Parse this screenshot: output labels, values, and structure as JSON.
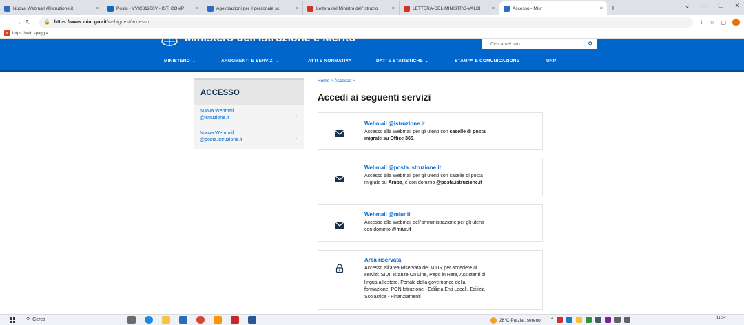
{
  "browser": {
    "tabs": [
      {
        "title": "Nuova Webmail @istruzione.it",
        "color": "#2b6cc4"
      },
      {
        "title": "Posta - VVIC81200V - IST. COMP",
        "color": "#0f6cbd"
      },
      {
        "title": "Agevolazioni per il personale sc",
        "color": "#2b6cc4"
      },
      {
        "title": "Lettera del Ministro dell'Istruzio",
        "color": "#d93025"
      },
      {
        "title": "LETTERA-DEL-MINISTRO-VALDI",
        "color": "#d93025"
      },
      {
        "title": "Accesso - Miur",
        "color": "#2b6cc4",
        "active": true
      }
    ],
    "url_host": "https://www.miur.gov.it",
    "url_path": "/web/guest/accesso",
    "bookmark": "https://web.spaggia..."
  },
  "site": {
    "title": "Ministero dell'Istruzione e Merito",
    "search_placeholder": "Cerca nel sito",
    "nav": [
      {
        "label": "MINISTERO",
        "caret": true
      },
      {
        "label": "ARGOMENTI E SERVIZI",
        "caret": true
      },
      {
        "label": "ATTI E NORMATIVA",
        "caret": false
      },
      {
        "label": "DATI E STATISTICHE",
        "caret": true
      },
      {
        "label": "STAMPA E COMUNICAZIONE",
        "caret": false
      },
      {
        "label": "URP",
        "caret": false
      }
    ]
  },
  "sidebar": {
    "heading": "ACCESSO",
    "items": [
      {
        "line1": "Nuova Webmail",
        "line2": "@istruzione.it"
      },
      {
        "line1": "Nuova Webmail",
        "line2": "@posta.istruzione.it"
      }
    ]
  },
  "main": {
    "breadcrumb": "Home > Accesso >",
    "title": "Accedi ai seguenti servizi",
    "cards": [
      {
        "icon": "mail-icon",
        "title": "Webmail @istruzione.it",
        "desc_lines": [
          [
            {
              "t": "Accesso alla Webmail per gli utenti con "
            },
            {
              "t": "caselle di posta",
              "b": true
            }
          ],
          [
            {
              "t": "migrate su Office 365",
              "b": true
            },
            {
              "t": "."
            }
          ]
        ]
      },
      {
        "icon": "mail-icon",
        "title": "Webmail @posta.istruzione.it",
        "desc_lines": [
          [
            {
              "t": "Accesso alla Webmail per gli utenti con caselle di posta"
            }
          ],
          [
            {
              "t": "migrate su "
            },
            {
              "t": "Aruba",
              "b": true
            },
            {
              "t": ", e con dominio "
            },
            {
              "t": "@posta.istruzione.it",
              "b": true
            }
          ]
        ]
      },
      {
        "icon": "mail-icon",
        "title": "Webmail @miur.it",
        "desc_lines": [
          [
            {
              "t": "Accesso alla Webmail dell'amministrazione per gli utenti"
            }
          ],
          [
            {
              "t": "con dominio "
            },
            {
              "t": "@miur.it",
              "b": true
            }
          ]
        ]
      },
      {
        "icon": "lock-icon",
        "title": "Area riservata",
        "desc_lines": [
          [
            {
              "t": "Accesso all'area Riservata del MIUR per accedere ai"
            }
          ],
          [
            {
              "t": "servizi: SIDI, Istanze On Line, Pago in Rete, Assistenti di"
            }
          ],
          [
            {
              "t": "lingua all'estero, Portale della governance della"
            }
          ],
          [
            {
              "t": "formazione, PON Istruzione - Edilizia Enti Locali. Edilizia"
            }
          ],
          [
            {
              "t": "Scolastica - Finanziamenti"
            }
          ]
        ]
      }
    ]
  },
  "taskbar": {
    "search_label": "Cerca",
    "weather": "26°C  Parzial. sereno",
    "time": "11:34"
  },
  "colors": {
    "brand_blue": "#0066cc",
    "nav_dark": "#004d99",
    "sidebar_bg": "#f4f4f4"
  }
}
